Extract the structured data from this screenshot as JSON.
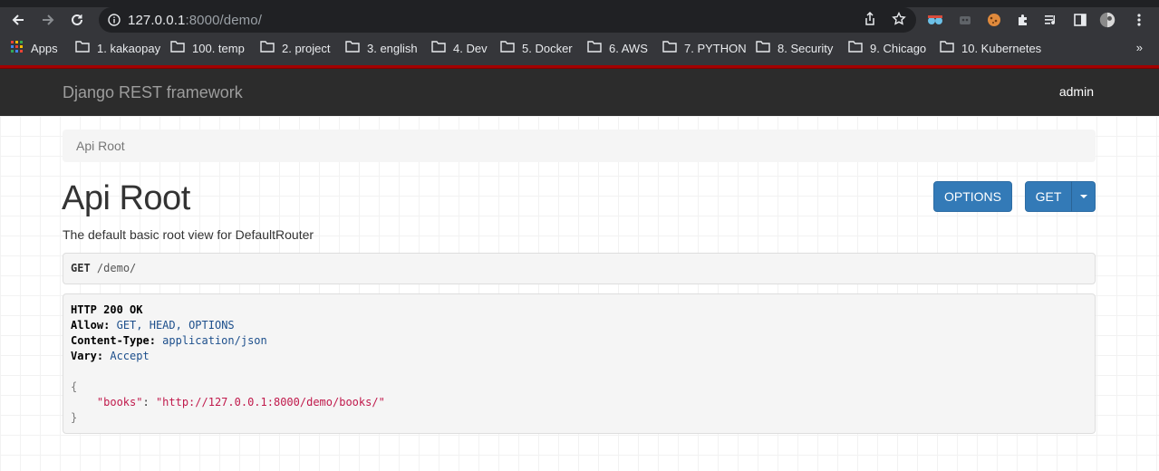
{
  "browser": {
    "url_host": "127.0.0.1",
    "url_rest": ":8000/demo/",
    "bookmarks": [
      {
        "label": "Apps"
      },
      {
        "label": "1. kakaopay"
      },
      {
        "label": "100. temp"
      },
      {
        "label": "2. project"
      },
      {
        "label": "3. english"
      },
      {
        "label": "4. Dev"
      },
      {
        "label": "5. Docker"
      },
      {
        "label": "6. AWS"
      },
      {
        "label": "7. PYTHON"
      },
      {
        "label": "8. Security"
      },
      {
        "label": "9. Chicago"
      },
      {
        "label": "10. Kubernetes"
      }
    ],
    "overflow": "»"
  },
  "navbar": {
    "brand": "Django REST framework",
    "user": "admin"
  },
  "breadcrumb": {
    "item": "Api Root"
  },
  "page": {
    "title": "Api Root",
    "description": "The default basic root view for DefaultRouter"
  },
  "buttons": {
    "options": "OPTIONS",
    "get": "GET"
  },
  "request": {
    "method": "GET",
    "path": "/demo/"
  },
  "response": {
    "status": "HTTP 200 OK",
    "headers": [
      {
        "name": "Allow:",
        "value": "GET, HEAD, OPTIONS"
      },
      {
        "name": "Content-Type:",
        "value": "application/json"
      },
      {
        "name": "Vary:",
        "value": "Accept"
      }
    ],
    "body_open": "{",
    "body_key": "\"books\"",
    "body_sep": ": ",
    "body_value": "\"http://127.0.0.1:8000/demo/books/\"",
    "body_close": "}"
  },
  "colors": {
    "navbar": "#2c2c2c",
    "primary_button": "#337ab7",
    "redline": "#a30000"
  }
}
